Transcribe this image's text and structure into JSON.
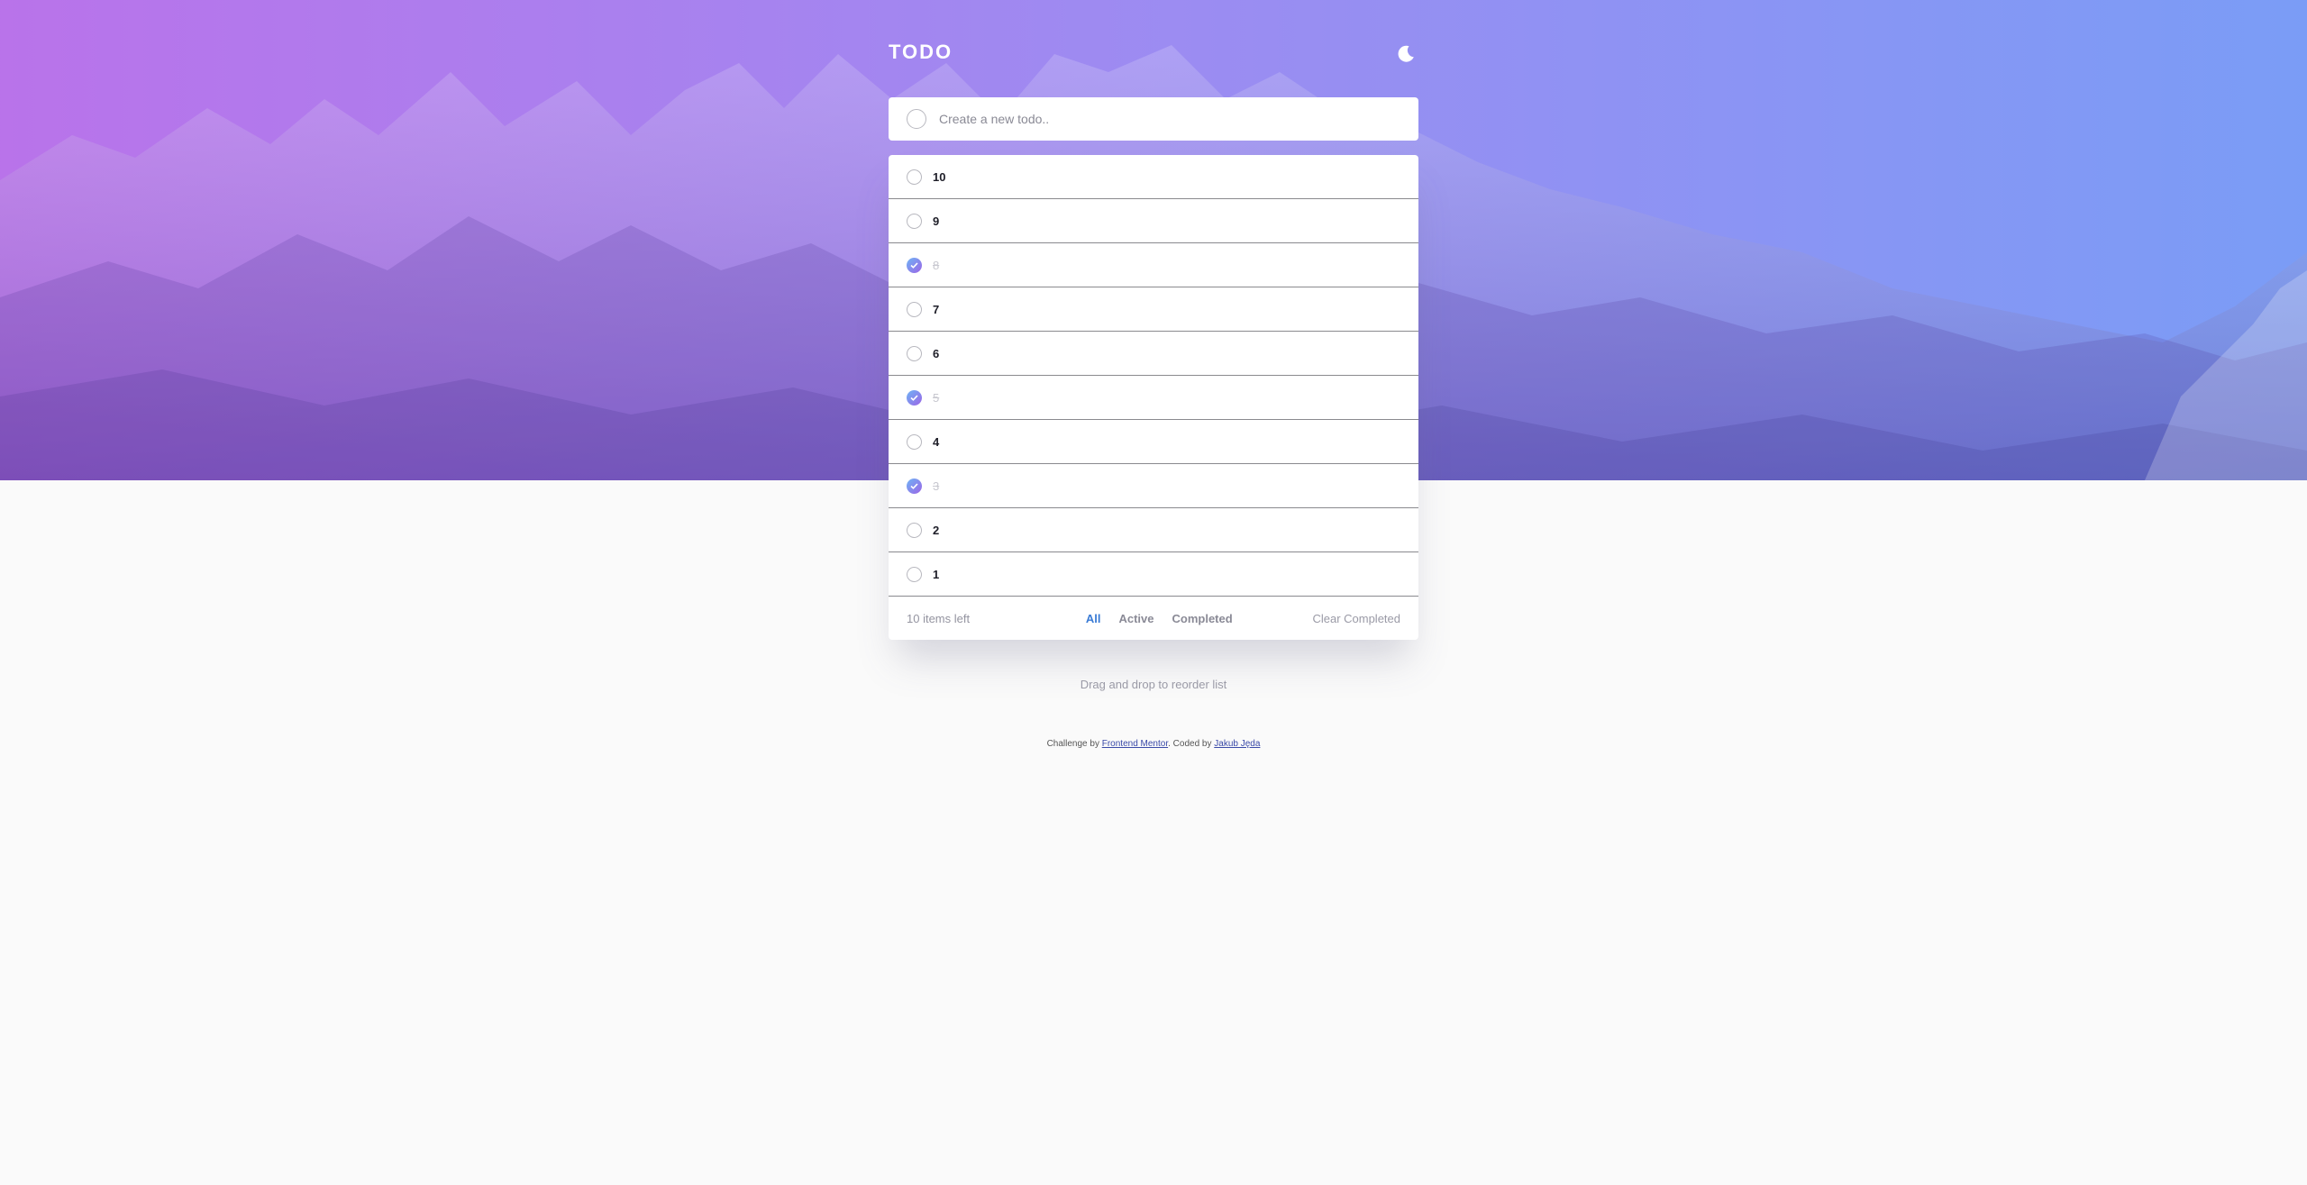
{
  "header": {
    "title": "TODO",
    "theme_icon": "moon-icon"
  },
  "new_todo": {
    "placeholder": "Create a new todo.."
  },
  "todos": [
    {
      "label": "10",
      "completed": false
    },
    {
      "label": "9",
      "completed": false
    },
    {
      "label": "8",
      "completed": true
    },
    {
      "label": "7",
      "completed": false
    },
    {
      "label": "6",
      "completed": false
    },
    {
      "label": "5",
      "completed": true
    },
    {
      "label": "4",
      "completed": false
    },
    {
      "label": "3",
      "completed": true
    },
    {
      "label": "2",
      "completed": false
    },
    {
      "label": "1",
      "completed": false
    }
  ],
  "footer": {
    "items_left": "10 items left",
    "filters": {
      "all": "All",
      "active": "Active",
      "completed": "Completed"
    },
    "active_filter": "all",
    "clear": "Clear Completed"
  },
  "hint": "Drag and drop to reorder list",
  "credit": {
    "prefix": "Challenge by",
    "link1": "Frontend Mentor",
    "middle": ". Coded by",
    "link2": "Jakub Jęda"
  },
  "colors": {
    "accent": "#3a7bd5",
    "check_gradient_start": "#6fb4f5",
    "check_gradient_end": "#9b64e6",
    "hero_left": "#b060e8",
    "hero_right": "#648cf5"
  }
}
